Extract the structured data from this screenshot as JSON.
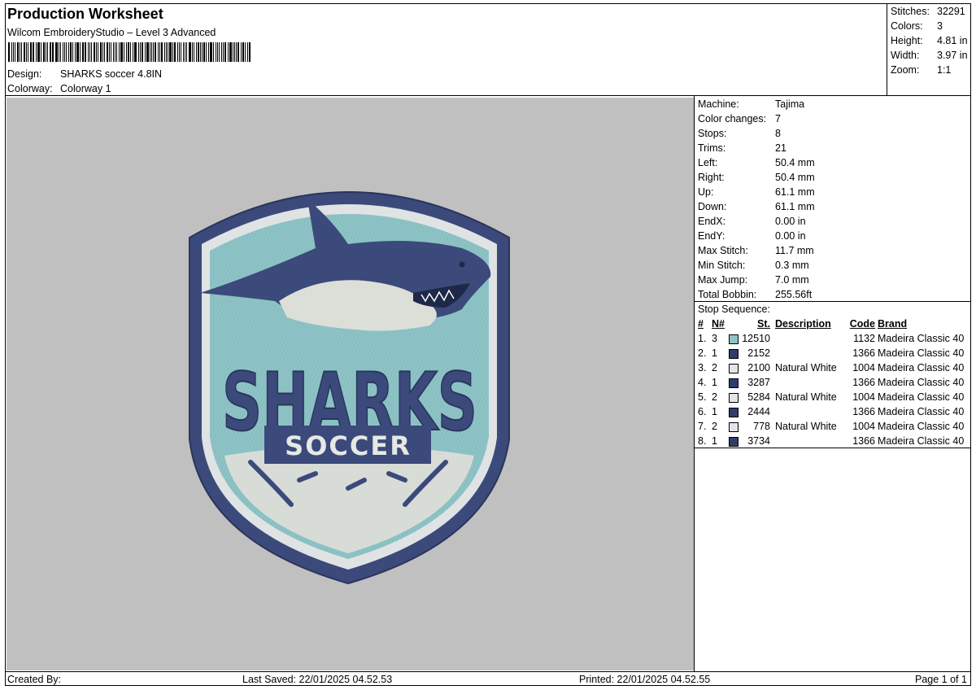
{
  "header": {
    "title": "Production Worksheet",
    "software": "Wilcom EmbroideryStudio – Level 3 Advanced",
    "design_label": "Design:",
    "design_value": "SHARKS soccer 4.8IN",
    "colorway_label": "Colorway:",
    "colorway_value": "Colorway 1"
  },
  "summary": {
    "stitches_label": "Stitches:",
    "stitches": "32291",
    "colors_label": "Colors:",
    "colors": "3",
    "height_label": "Height:",
    "height": "4.81 in",
    "width_label": "Width:",
    "width": "3.97 in",
    "zoom_label": "Zoom:",
    "zoom": "1:1"
  },
  "machine_info": [
    {
      "label": "Machine:",
      "value": "Tajima"
    },
    {
      "label": "Color changes:",
      "value": "7"
    },
    {
      "label": "Stops:",
      "value": "8"
    },
    {
      "label": "Trims:",
      "value": "21"
    },
    {
      "label": "Left:",
      "value": "50.4 mm"
    },
    {
      "label": "Right:",
      "value": "50.4 mm"
    },
    {
      "label": "Up:",
      "value": "61.1 mm"
    },
    {
      "label": "Down:",
      "value": "61.1 mm"
    },
    {
      "label": "EndX:",
      "value": "0.00 in"
    },
    {
      "label": "EndY:",
      "value": "0.00 in"
    },
    {
      "label": "Max Stitch:",
      "value": "11.7 mm"
    },
    {
      "label": "Min Stitch:",
      "value": "0.3 mm"
    },
    {
      "label": "Max Jump:",
      "value": "7.0 mm"
    },
    {
      "label": "Total Bobbin:",
      "value": "255.56ft"
    }
  ],
  "stop_sequence": {
    "title": "Stop Sequence:",
    "headers": {
      "num": "#",
      "n": "N#",
      "st": "St.",
      "desc": "Description",
      "code": "Code",
      "brand": "Brand"
    },
    "rows": [
      {
        "num": "1.",
        "n": "3",
        "color": "#8ec3c6",
        "st": "12510",
        "desc": "",
        "code": "1132",
        "brand": "Madeira Classic 40"
      },
      {
        "num": "2.",
        "n": "1",
        "color": "#2e3d6b",
        "st": "2152",
        "desc": "",
        "code": "1366",
        "brand": "Madeira Classic 40"
      },
      {
        "num": "3.",
        "n": "2",
        "color": "#e2e4e8",
        "st": "2100",
        "desc": "Natural White",
        "code": "1004",
        "brand": "Madeira Classic 40"
      },
      {
        "num": "4.",
        "n": "1",
        "color": "#2e3d6b",
        "st": "3287",
        "desc": "",
        "code": "1366",
        "brand": "Madeira Classic 40"
      },
      {
        "num": "5.",
        "n": "2",
        "color": "#e2e4e8",
        "st": "5284",
        "desc": "Natural White",
        "code": "1004",
        "brand": "Madeira Classic 40"
      },
      {
        "num": "6.",
        "n": "1",
        "color": "#2e3d6b",
        "st": "2444",
        "desc": "",
        "code": "1366",
        "brand": "Madeira Classic 40"
      },
      {
        "num": "7.",
        "n": "2",
        "color": "#e2e4e8",
        "st": "778",
        "desc": "Natural White",
        "code": "1004",
        "brand": "Madeira Classic 40"
      },
      {
        "num": "8.",
        "n": "1",
        "color": "#2e3d6b",
        "st": "3734",
        "desc": "",
        "code": "1366",
        "brand": "Madeira Classic 40"
      }
    ]
  },
  "patch": {
    "word_top": "SHARKS",
    "word_bottom": "SOCCER"
  },
  "footer": {
    "created_by_label": "Created By:",
    "last_saved": "Last Saved: 22/01/2025 04.52.53",
    "printed": "Printed: 22/01/2025 04.52.55",
    "page": "Page 1 of 1"
  }
}
